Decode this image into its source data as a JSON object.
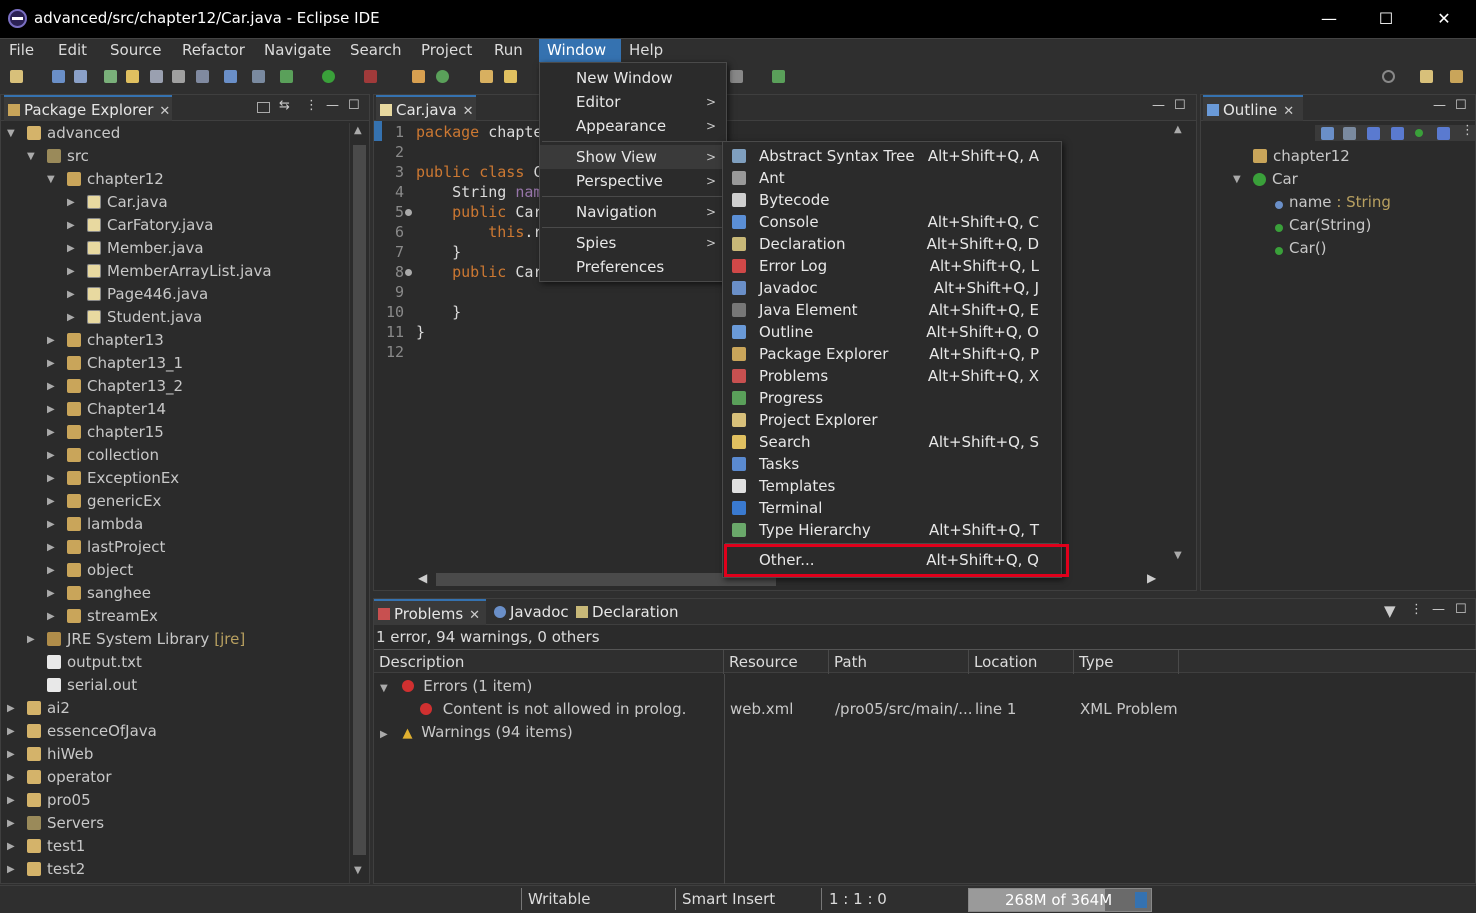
{
  "window": {
    "title": "advanced/src/chapter12/Car.java - Eclipse IDE",
    "minimize": "—",
    "maximize": "☐",
    "close": "✕"
  },
  "menubar": [
    "File",
    "Edit",
    "Source",
    "Refactor",
    "Navigate",
    "Search",
    "Project",
    "Run",
    "Window",
    "Help"
  ],
  "package_explorer": {
    "tab_label": "Package Explorer",
    "tree": [
      {
        "label": "advanced",
        "type": "project",
        "indent": 0,
        "toggle": "v"
      },
      {
        "label": "src",
        "type": "folder",
        "indent": 1,
        "toggle": "v"
      },
      {
        "label": "chapter12",
        "type": "package",
        "indent": 2,
        "toggle": "v"
      },
      {
        "label": "Car.java",
        "type": "java",
        "indent": 3,
        "toggle": ">"
      },
      {
        "label": "CarFatory.java",
        "type": "java",
        "indent": 3,
        "toggle": ">"
      },
      {
        "label": "Member.java",
        "type": "java",
        "indent": 3,
        "toggle": ">"
      },
      {
        "label": "MemberArrayList.java",
        "type": "java",
        "indent": 3,
        "toggle": ">"
      },
      {
        "label": "Page446.java",
        "type": "java",
        "indent": 3,
        "toggle": ">"
      },
      {
        "label": "Student.java",
        "type": "java",
        "indent": 3,
        "toggle": ">"
      },
      {
        "label": "chapter13",
        "type": "package",
        "indent": 2,
        "toggle": ">"
      },
      {
        "label": "Chapter13_1",
        "type": "package",
        "indent": 2,
        "toggle": ">"
      },
      {
        "label": "Chapter13_2",
        "type": "package",
        "indent": 2,
        "toggle": ">"
      },
      {
        "label": "Chapter14",
        "type": "package",
        "indent": 2,
        "toggle": ">"
      },
      {
        "label": "chapter15",
        "type": "package",
        "indent": 2,
        "toggle": ">"
      },
      {
        "label": "collection",
        "type": "package",
        "indent": 2,
        "toggle": ">"
      },
      {
        "label": "ExceptionEx",
        "type": "package",
        "indent": 2,
        "toggle": ">"
      },
      {
        "label": "genericEx",
        "type": "package",
        "indent": 2,
        "toggle": ">"
      },
      {
        "label": "lambda",
        "type": "package",
        "indent": 2,
        "toggle": ">"
      },
      {
        "label": "lastProject",
        "type": "package",
        "indent": 2,
        "toggle": ">"
      },
      {
        "label": "object",
        "type": "package",
        "indent": 2,
        "toggle": ">"
      },
      {
        "label": "sanghee",
        "type": "package",
        "indent": 2,
        "toggle": ">"
      },
      {
        "label": "streamEx",
        "type": "package",
        "indent": 2,
        "toggle": ">"
      },
      {
        "label": "JRE System Library",
        "suffix": "[jre]",
        "type": "library",
        "indent": 1,
        "toggle": ">"
      },
      {
        "label": "output.txt",
        "type": "text",
        "indent": 1,
        "toggle": ""
      },
      {
        "label": "serial.out",
        "type": "text",
        "indent": 1,
        "toggle": ""
      },
      {
        "label": "ai2",
        "type": "project",
        "indent": 0,
        "toggle": ">"
      },
      {
        "label": "essenceOfJava",
        "type": "project",
        "indent": 0,
        "toggle": ">"
      },
      {
        "label": "hiWeb",
        "type": "project",
        "indent": 0,
        "toggle": ">"
      },
      {
        "label": "operator",
        "type": "project",
        "indent": 0,
        "toggle": ">"
      },
      {
        "label": "pro05",
        "type": "project",
        "indent": 0,
        "toggle": ">"
      },
      {
        "label": "Servers",
        "type": "folder",
        "indent": 0,
        "toggle": ">"
      },
      {
        "label": "test1",
        "type": "project",
        "indent": 0,
        "toggle": ">"
      },
      {
        "label": "test2",
        "type": "project",
        "indent": 0,
        "toggle": ">"
      }
    ]
  },
  "editor": {
    "tab_label": "Car.java",
    "line_numbers": [
      "1",
      "2",
      "3",
      "4",
      "5",
      "6",
      "7",
      "8",
      "9",
      "10",
      "11",
      "12"
    ],
    "lines": [
      [
        {
          "t": "package",
          "c": "kw"
        },
        {
          "t": " chapte",
          "c": ""
        }
      ],
      [],
      [
        {
          "t": "public class ",
          "c": "kw"
        },
        {
          "t": "C",
          "c": ""
        }
      ],
      [
        {
          "t": "    String ",
          "c": ""
        },
        {
          "t": "nam",
          "c": "fieldc"
        }
      ],
      [
        {
          "t": "    public ",
          "c": "kw"
        },
        {
          "t": "Car",
          "c": ""
        }
      ],
      [
        {
          "t": "        this",
          "c": "kw"
        },
        {
          "t": ".r",
          "c": ""
        }
      ],
      [
        {
          "t": "    }",
          "c": ""
        }
      ],
      [
        {
          "t": "    public ",
          "c": "kw"
        },
        {
          "t": "Car",
          "c": ""
        }
      ],
      [],
      [
        {
          "t": "    }",
          "c": ""
        }
      ],
      [
        {
          "t": "}",
          "c": ""
        }
      ],
      []
    ]
  },
  "window_menu": {
    "items": [
      "New Window",
      "Editor",
      "Appearance",
      "Show View",
      "Perspective",
      "Navigation",
      "Spies",
      "Preferences"
    ]
  },
  "show_view_menu": {
    "items": [
      {
        "label": "Abstract Syntax Tree",
        "shortcut": "Alt+Shift+Q, A",
        "icon_color": "#7f9fbf"
      },
      {
        "label": "Ant",
        "shortcut": "",
        "icon_color": "#999999"
      },
      {
        "label": "Bytecode",
        "shortcut": "",
        "icon_color": "#cfcfcf"
      },
      {
        "label": "Console",
        "shortcut": "Alt+Shift+Q, C",
        "icon_color": "#5b8fd6"
      },
      {
        "label": "Declaration",
        "shortcut": "Alt+Shift+Q, D",
        "icon_color": "#c8b878"
      },
      {
        "label": "Error Log",
        "shortcut": "Alt+Shift+Q, L",
        "icon_color": "#d04848"
      },
      {
        "label": "Javadoc",
        "shortcut": "Alt+Shift+Q, J",
        "icon_color": "#6a8fc8"
      },
      {
        "label": "Java Element",
        "shortcut": "Alt+Shift+Q, E",
        "icon_color": "#777777"
      },
      {
        "label": "Outline",
        "shortcut": "Alt+Shift+Q, O",
        "icon_color": "#6a9ad8"
      },
      {
        "label": "Package Explorer",
        "shortcut": "Alt+Shift+Q, P",
        "icon_color": "#c9a55a"
      },
      {
        "label": "Problems",
        "shortcut": "Alt+Shift+Q, X",
        "icon_color": "#c85050"
      },
      {
        "label": "Progress",
        "shortcut": "",
        "icon_color": "#5aa05a"
      },
      {
        "label": "Project Explorer",
        "shortcut": "",
        "icon_color": "#d8c07a"
      },
      {
        "label": "Search",
        "shortcut": "Alt+Shift+Q, S",
        "icon_color": "#e0c060"
      },
      {
        "label": "Tasks",
        "shortcut": "",
        "icon_color": "#5a8ad0"
      },
      {
        "label": "Templates",
        "shortcut": "",
        "icon_color": "#e0e0e0"
      },
      {
        "label": "Terminal",
        "shortcut": "",
        "icon_color": "#3a7ad0"
      },
      {
        "label": "Type Hierarchy",
        "shortcut": "Alt+Shift+Q, T",
        "icon_color": "#6aa86a"
      }
    ],
    "other": {
      "label": "Other...",
      "shortcut": "Alt+Shift+Q, Q"
    },
    "highlight_color": "#e0001b"
  },
  "outline": {
    "tab_label": "Outline",
    "items": [
      {
        "label": "chapter12",
        "type": "package"
      },
      {
        "label": "Car",
        "type": "class"
      },
      {
        "label": "name",
        "suffix": " : String",
        "type": "field"
      },
      {
        "label": "Car(String)",
        "type": "method"
      },
      {
        "label": "Car()",
        "type": "method"
      }
    ]
  },
  "bottom": {
    "tabs": [
      "Problems",
      "Javadoc",
      "Declaration"
    ],
    "summary": "1 error, 94 warnings, 0 others",
    "columns": [
      "Description",
      "Resource",
      "Path",
      "Location",
      "Type"
    ],
    "groups": [
      {
        "label": "Errors (1 item)",
        "expanded": true
      },
      {
        "label": "Warnings (94 items)",
        "expanded": false
      }
    ],
    "row": {
      "description": "Content is not allowed in prolog.",
      "resource": "web.xml",
      "path": "/pro05/src/main/...",
      "location": "line 1",
      "type": "XML Problem"
    }
  },
  "statusbar": {
    "writable": "Writable",
    "insert_mode": "Smart Insert",
    "position": "1 : 1 : 0",
    "memory": "268M of 364M"
  },
  "colors": {
    "accent": "#3572b0",
    "highlight_box": "#e0001b",
    "background": "#2f2f2f"
  }
}
